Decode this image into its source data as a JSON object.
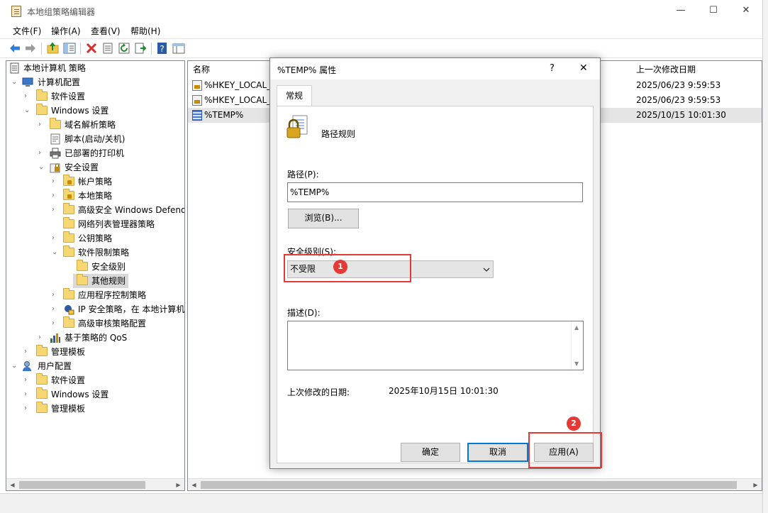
{
  "window": {
    "title": "本地组策略编辑器",
    "controls": {
      "minimize": "—",
      "maximize": "☐",
      "close": "✕"
    }
  },
  "menu": [
    {
      "label": "文件(F)"
    },
    {
      "label": "操作(A)"
    },
    {
      "label": "查看(V)"
    },
    {
      "label": "帮助(H)"
    }
  ],
  "tree": {
    "items": [
      {
        "label": "本地计算机 策略"
      },
      {
        "label": "计算机配置"
      },
      {
        "label": "软件设置"
      },
      {
        "label": "Windows 设置"
      },
      {
        "label": "域名解析策略"
      },
      {
        "label": "脚本(启动/关机)"
      },
      {
        "label": "已部署的打印机"
      },
      {
        "label": "安全设置"
      },
      {
        "label": "帐户策略"
      },
      {
        "label": "本地策略"
      },
      {
        "label": "高级安全 Windows Defend"
      },
      {
        "label": "网络列表管理器策略"
      },
      {
        "label": "公钥策略"
      },
      {
        "label": "软件限制策略"
      },
      {
        "label": "安全级别"
      },
      {
        "label": "其他规则"
      },
      {
        "label": "应用程序控制策略"
      },
      {
        "label": "IP 安全策略，在 本地计算机"
      },
      {
        "label": "高级审核策略配置"
      },
      {
        "label": "基于策略的 QoS"
      },
      {
        "label": "管理模板"
      },
      {
        "label": "用户配置"
      },
      {
        "label": "软件设置"
      },
      {
        "label": "Windows 设置"
      },
      {
        "label": "管理模板"
      }
    ]
  },
  "list": {
    "columns": {
      "name": "名称",
      "modified": "上一次修改日期"
    },
    "rows": [
      {
        "name": "%HKEY_LOCAL_M",
        "modified": "2025/06/23  9:59:53"
      },
      {
        "name": "%HKEY_LOCAL_M",
        "modified": "2025/06/23  9:59:53"
      },
      {
        "name": "%TEMP%",
        "modified": "2025/10/15  10:01:30"
      }
    ]
  },
  "dialog": {
    "title": "%TEMP% 属性",
    "help": "?",
    "close": "✕",
    "tab": "常规",
    "rule_type": "路径规则",
    "path_label": "路径(P):",
    "path_value": "%TEMP%",
    "browse_label": "浏览(B)...",
    "security_level_label": "安全级别(S):",
    "security_level_value": "不受限",
    "description_label": "描述(D):",
    "last_modified_label": "上次修改的日期:",
    "last_modified_value": "2025年10月15日  10:01:30",
    "ok_label": "确定",
    "cancel_label": "取消",
    "apply_label": "应用(A)"
  },
  "annotations": [
    {
      "number": "1",
      "color": "#e53935"
    },
    {
      "number": "2",
      "color": "#e53935"
    }
  ]
}
